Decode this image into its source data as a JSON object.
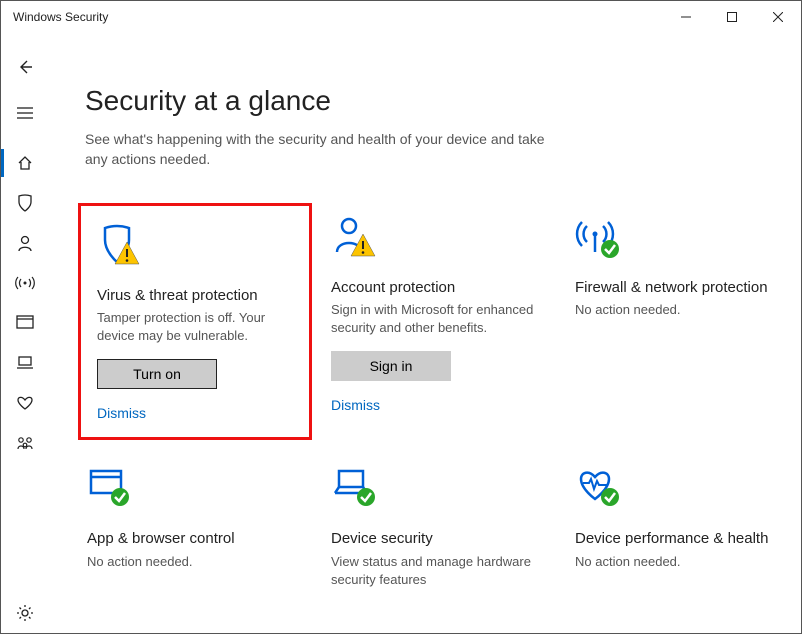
{
  "window": {
    "title": "Windows Security"
  },
  "page": {
    "title": "Security at a glance",
    "subtitle": "See what's happening with the security and health of your device and take any actions needed."
  },
  "sidebar": {
    "items": [
      {
        "name": "back"
      },
      {
        "name": "menu"
      },
      {
        "name": "home",
        "active": true
      },
      {
        "name": "virus"
      },
      {
        "name": "account"
      },
      {
        "name": "firewall"
      },
      {
        "name": "app-browser"
      },
      {
        "name": "device-security"
      },
      {
        "name": "device-performance"
      },
      {
        "name": "family"
      }
    ],
    "settings": {
      "name": "settings"
    }
  },
  "cards": {
    "virus": {
      "title": "Virus & threat protection",
      "desc": "Tamper protection is off. Your device may be vulnerable.",
      "button": "Turn on",
      "dismiss": "Dismiss"
    },
    "account": {
      "title": "Account protection",
      "desc": "Sign in with Microsoft for enhanced security and other benefits.",
      "button": "Sign in",
      "dismiss": "Dismiss"
    },
    "firewall": {
      "title": "Firewall & network protection",
      "desc": "No action needed."
    },
    "appbrowser": {
      "title": "App & browser control",
      "desc": "No action needed."
    },
    "devicesec": {
      "title": "Device security",
      "desc": "View status and manage hardware security features"
    },
    "perf": {
      "title": "Device performance & health",
      "desc": "No action needed."
    }
  }
}
